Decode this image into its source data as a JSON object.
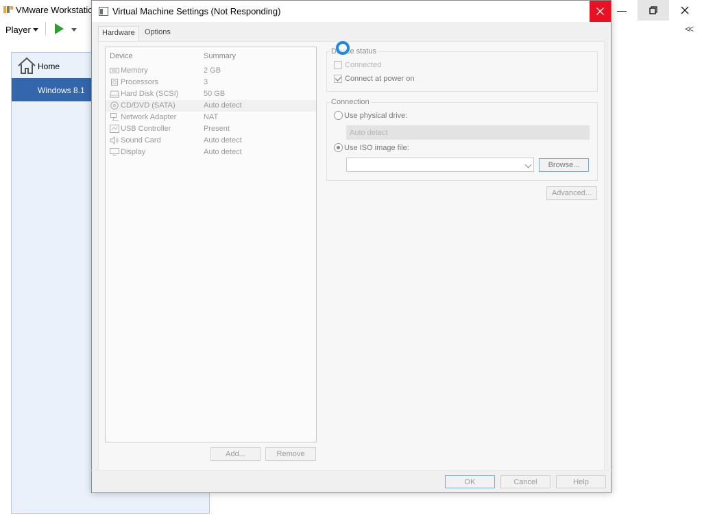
{
  "background_app": {
    "title": "VMware Workstation",
    "toolbar": {
      "player_label": "Player"
    },
    "library": {
      "home_label": "Home",
      "vm_label": "Windows 8.1"
    }
  },
  "dialog": {
    "title": "Virtual Machine Settings (Not Responding)",
    "tabs": [
      {
        "label": "Hardware",
        "active": true
      },
      {
        "label": "Options",
        "active": false
      }
    ],
    "device_list": {
      "columns": [
        "Device",
        "Summary"
      ],
      "rows": [
        {
          "icon": "memory-icon",
          "device": "Memory",
          "summary": "2 GB"
        },
        {
          "icon": "processor-icon",
          "device": "Processors",
          "summary": "3"
        },
        {
          "icon": "hard-disk-icon",
          "device": "Hard Disk (SCSI)",
          "summary": "50 GB"
        },
        {
          "icon": "cd-dvd-icon",
          "device": "CD/DVD (SATA)",
          "summary": "Auto detect",
          "selected": true
        },
        {
          "icon": "network-adapter-icon",
          "device": "Network Adapter",
          "summary": "NAT"
        },
        {
          "icon": "usb-icon",
          "device": "USB Controller",
          "summary": "Present"
        },
        {
          "icon": "sound-card-icon",
          "device": "Sound Card",
          "summary": "Auto detect"
        },
        {
          "icon": "display-icon",
          "device": "Display",
          "summary": "Auto detect"
        }
      ],
      "add_label": "Add...",
      "remove_label": "Remove"
    },
    "device_status": {
      "title": "Device status",
      "connected_label": "Connected",
      "connected_checked": false,
      "connect_at_power_on_label": "Connect at power on",
      "connect_at_power_on_checked": true
    },
    "connection": {
      "title": "Connection",
      "physical_drive_label": "Use physical drive:",
      "physical_drive_selected": false,
      "physical_drive_value": "Auto detect",
      "iso_label": "Use ISO image file:",
      "iso_selected": true,
      "iso_value": "",
      "browse_label": "Browse..."
    },
    "advanced_label": "Advanced...",
    "footer": {
      "ok_label": "OK",
      "cancel_label": "Cancel",
      "help_label": "Help"
    }
  },
  "colors": {
    "close_red": "#e81123",
    "selection_blue": "#3366aa",
    "play_green": "#2f9e2f",
    "busy_spinner": "#1e88e5"
  }
}
